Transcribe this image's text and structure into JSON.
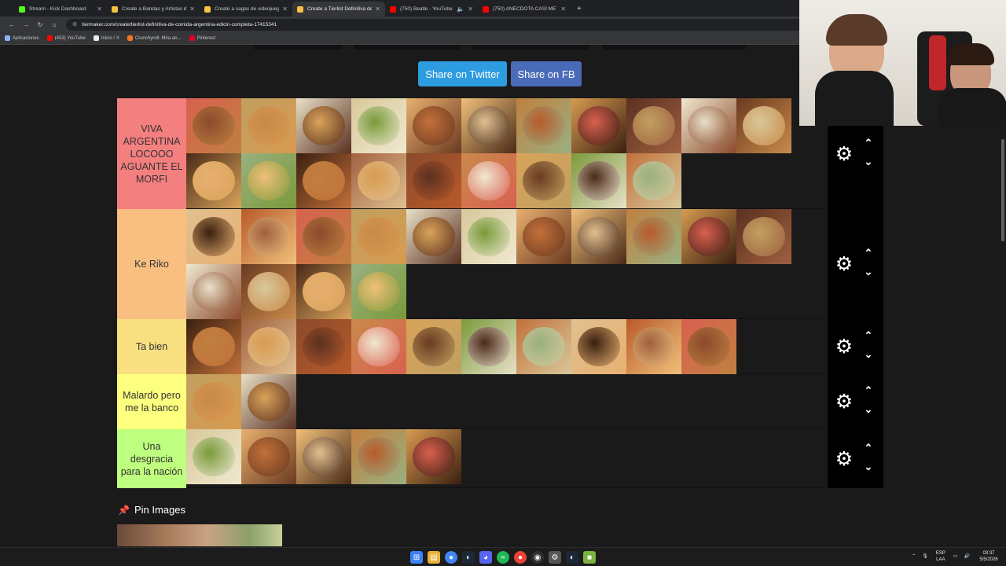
{
  "browser": {
    "tabs": [
      {
        "title": "Stream - Kick Dashboard",
        "color": "#53fc18",
        "active": false
      },
      {
        "title": "Create a Bandas y Artistas de R",
        "color": "#f5c242",
        "active": false
      },
      {
        "title": "Create a sagas de videojuegos",
        "color": "#f5c242",
        "active": false
      },
      {
        "title": "Create a Tierlist Definitiva de C",
        "color": "#f5c242",
        "active": true
      },
      {
        "title": "(750) Beatle - YouTube",
        "color": "#ff0000",
        "active": false
      },
      {
        "title": "",
        "color": "#9aa0a6",
        "active": false
      },
      {
        "title": "(750) ANÉCDOTA CASI ME MA",
        "color": "#ff0000",
        "active": false
      }
    ],
    "url": "tiermaker.com/create/tierlist-definitiva-de-comida-argentina-edicin-completa-17415341",
    "bookmarks": [
      {
        "label": "Aplicaciones",
        "color": "#8ab4f8"
      },
      {
        "label": "(453) YouTube",
        "color": "#ff0000"
      },
      {
        "label": "Inicio / X",
        "color": "#e8eaed"
      },
      {
        "label": "Crunchyroll: Mira an...",
        "color": "#f47521"
      },
      {
        "label": "Pinterest",
        "color": "#e60023"
      }
    ]
  },
  "share": {
    "twitter": "Share on Twitter",
    "fb": "Share on FB"
  },
  "tiers": [
    {
      "label": "VIVA ARGENTINA LOCOOO AGUANTE EL MORFI",
      "color": "#f47f7f",
      "count": 20
    },
    {
      "label": "Ke Riko",
      "color": "#f8bf80",
      "count": 15
    },
    {
      "label": "Ta bien",
      "color": "#f8df80",
      "count": 10
    },
    {
      "label": "Malardo pero me la banco",
      "color": "#fdff7f",
      "count": 2
    },
    {
      "label": "Una desgracia para la nación",
      "color": "#bfff7f",
      "count": 5
    }
  ],
  "food_colors": [
    "#8b4a2b",
    "#c98a4a",
    "#d9a35a",
    "#7a9a3a",
    "#c2703a",
    "#e0c090",
    "#b85a2a",
    "#d96050",
    "#c0a060",
    "#e8e0c8",
    "#d8c89a",
    "#e8b070",
    "#f0c07a",
    "#c08040",
    "#d89a50",
    "#5a3020",
    "#f0e8d0",
    "#6a3a20",
    "#4a2a18",
    "#9ab080",
    "#3a2010",
    "#a06040"
  ],
  "pin": {
    "title": "Pin Images"
  },
  "taskbar": {
    "lang": "ESP LAA",
    "time": "03:37",
    "date": "5/5/2026"
  }
}
